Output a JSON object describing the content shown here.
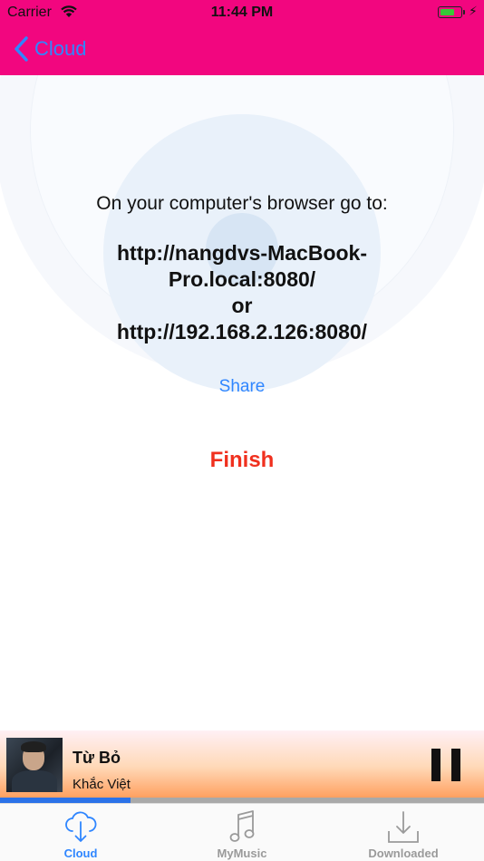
{
  "status_bar": {
    "carrier": "Carrier",
    "time": "11:44 PM",
    "battery_level": 0.7
  },
  "nav": {
    "back_label": "Cloud",
    "bar_color": "#f2067f",
    "accent_color": "#2f86ff"
  },
  "main": {
    "instruction": "On your computer's browser go to:",
    "url_lines": [
      "http://nangdvs-MacBook-",
      "Pro.local:8080/",
      "or",
      "http://192.168.2.126:8080/"
    ],
    "share_label": "Share",
    "finish_label": "Finish",
    "finish_color": "#f0301e"
  },
  "player": {
    "song_title": "Từ Bỏ",
    "artist": "Khắc Việt",
    "progress": 0.27,
    "control_icon": "pause-icon"
  },
  "tabs": [
    {
      "label": "Cloud",
      "icon": "cloud-download-icon",
      "active": true
    },
    {
      "label": "MyMusic",
      "icon": "music-note-icon",
      "active": false
    },
    {
      "label": "Downloaded",
      "icon": "download-tray-icon",
      "active": false
    }
  ]
}
